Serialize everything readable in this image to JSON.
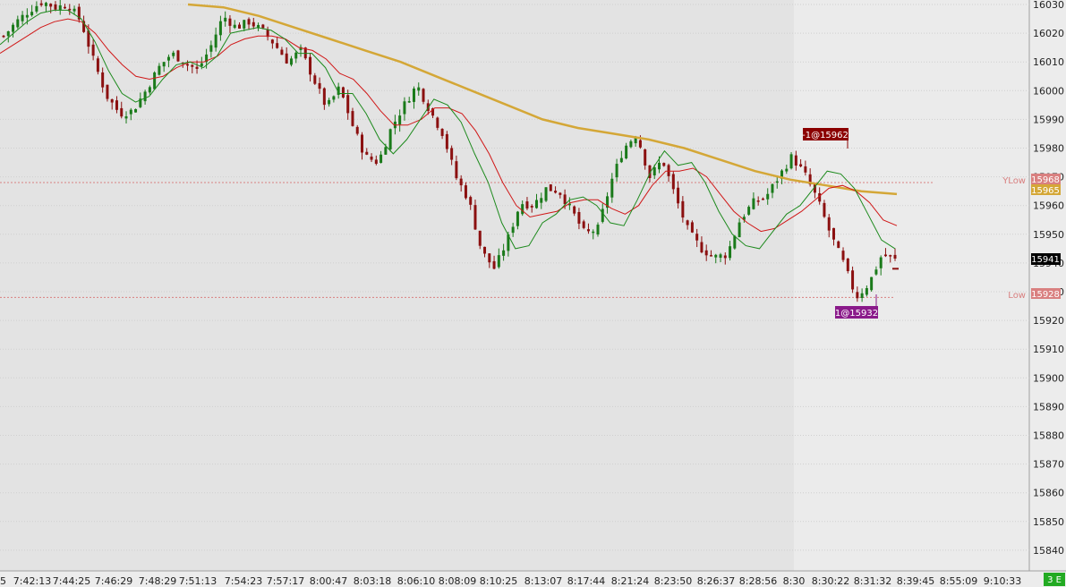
{
  "chart_data": {
    "type": "candlestick",
    "y_ticks": [
      16030,
      16020,
      16010,
      16000,
      15990,
      15980,
      15970,
      15960,
      15950,
      15940,
      15930,
      15920,
      15910,
      15900,
      15890,
      15880,
      15870,
      15860,
      15850,
      15840
    ],
    "ylim": [
      15835,
      16031
    ],
    "x_ticks": [
      "5",
      "7:42:13",
      "7:44:25",
      "7:46:29",
      "7:48:29",
      "7:51:13",
      "7:54:23",
      "7:57:17",
      "8:00:47",
      "8:03:18",
      "8:06:10",
      "8:08:09",
      "8:10:25",
      "8:13:07",
      "8:17:44",
      "8:21:24",
      "8:23:50",
      "8:26:37",
      "8:28:56",
      "8:30",
      "8:30:22",
      "8:31:32",
      "8:39:45",
      "8:55:09",
      "9:10:33"
    ],
    "close_path": [
      16019,
      16024,
      16028,
      16031,
      16029,
      16030,
      16024,
      16010,
      15998,
      15992,
      15993,
      16000,
      16008,
      16013,
      16010,
      16007,
      16015,
      16026,
      16022,
      16024,
      16021,
      16016,
      16010,
      16014,
      16004,
      15994,
      16001,
      15988,
      15977,
      15975,
      15987,
      15995,
      16002,
      15993,
      15985,
      15970,
      15962,
      15944,
      15938,
      15948,
      15961,
      15960,
      15966,
      15965,
      15958,
      15950,
      15952,
      15968,
      15980,
      15985,
      15970,
      15976,
      15963,
      15951,
      15945,
      15942,
      15943,
      15955,
      15961,
      15963,
      15970,
      15977,
      15971,
      15962,
      15950,
      15940,
      15928,
      15933,
      15943,
      15941
    ],
    "ma_fast": [
      16016,
      16020,
      16024,
      16027,
      16028,
      16028,
      16025,
      16017,
      16007,
      15999,
      15996,
      15998,
      16004,
      16009,
      16010,
      16008,
      16012,
      16020,
      16021,
      16022,
      16021,
      16018,
      16013,
      16013,
      16008,
      15999,
      15999,
      15992,
      15983,
      15978,
      15983,
      15990,
      15997,
      15995,
      15989,
      15978,
      15968,
      15954,
      15945,
      15946,
      15954,
      15957,
      15962,
      15963,
      15960,
      15954,
      15953,
      15962,
      15972,
      15979,
      15974,
      15975,
      15968,
      15958,
      15950,
      15946,
      15945,
      15951,
      15957,
      15960,
      15966,
      15972,
      15971,
      15966,
      15957,
      15948,
      15945
    ],
    "ma_slow": [
      16013,
      16016,
      16019,
      16022,
      16024,
      16025,
      16024,
      16020,
      16014,
      16009,
      16005,
      16004,
      16005,
      16008,
      16010,
      16010,
      16012,
      16016,
      16018,
      16019,
      16019,
      16018,
      16015,
      16014,
      16011,
      16006,
      16004,
      15999,
      15993,
      15988,
      15988,
      15990,
      15994,
      15994,
      15992,
      15986,
      15978,
      15968,
      15960,
      15956,
      15957,
      15958,
      15961,
      15962,
      15962,
      15959,
      15957,
      15960,
      15967,
      15972,
      15972,
      15973,
      15970,
      15964,
      15958,
      15954,
      15951,
      15952,
      15955,
      15958,
      15962,
      15966,
      15967,
      15965,
      15961,
      15955,
      15953
    ],
    "ma_long": [
      16030,
      16029,
      16026,
      16022,
      16018,
      16014,
      16010,
      16005,
      16000,
      15995,
      15990,
      15987,
      15985,
      15983,
      15980,
      15976,
      15972,
      15969,
      15967,
      15965,
      15964
    ],
    "last_price_tag": "15941",
    "levels": [
      {
        "name": "YLow",
        "label": "YLow",
        "value": "15968",
        "color": "#d98080"
      },
      {
        "name": "Low",
        "label": "Low",
        "value": "15928",
        "color": "#d98080"
      }
    ],
    "ma_long_tag": "15965",
    "fills": [
      {
        "label": "-1@15962",
        "color": "#8b0000"
      },
      {
        "label": "1@15932",
        "color": "#8a1a8a"
      }
    ],
    "corner_tag": "3 E",
    "colors": {
      "up": "#1a7a1a",
      "down": "#8b1010",
      "ma_fast": "#1d8a1d",
      "ma_slow": "#d01818",
      "ma_long": "#d4a737",
      "level": "#d98080",
      "bg_left": "#e3e3e3",
      "bg_right": "#ebebeb",
      "grid": "#cfcfcf"
    }
  }
}
